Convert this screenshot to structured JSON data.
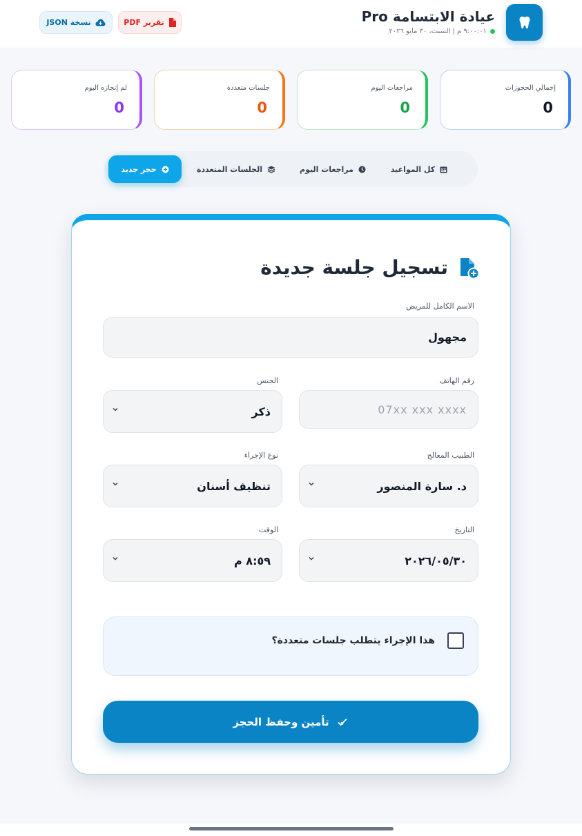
{
  "header": {
    "title": "عيادة الابتسامة Pro",
    "subtitle": "٩:٠٠:٠١ م | السبت، ٣٠ مايو ٢٠٢٦",
    "btn_pdf": "تقرير PDF",
    "btn_json": "نسخة JSON"
  },
  "stats": [
    {
      "label": "إجمالي الحجوزات",
      "value": "0"
    },
    {
      "label": "مراجعات اليوم",
      "value": "0"
    },
    {
      "label": "جلسات متعددة",
      "value": "0"
    },
    {
      "label": "لم إنجازه اليوم",
      "value": "0"
    }
  ],
  "tabs": {
    "all": "كل المواعيد",
    "today": "مراجعات اليوم",
    "multi": "الجلسات المتعددة",
    "new": "حجز جديد"
  },
  "form": {
    "title": "تسجيل جلسة جديدة",
    "name_label": "الاسم الكامل للمريض",
    "name_value": "مجهول",
    "phone_label": "رقم الهاتف",
    "phone_placeholder": "07xx  xxx  xxxx",
    "gender_label": "الجنس",
    "gender_value": "ذكر",
    "doctor_label": "الطبيب المعالج",
    "doctor_value": "د. سارة المنصور",
    "procedure_label": "نوع الإجراء",
    "procedure_value": "تنظيف أسنان",
    "date_label": "التاريخ",
    "date_value": "٢٠٢٦/٠٥/٣٠",
    "time_label": "الوقت",
    "time_value": "٨:٥٩ م",
    "multi_label": "هذا الإجراء يتطلب جلسات متعددة؟",
    "submit": "تأمين وحفظ الحجز"
  },
  "colors": {
    "primary": "#0b84c6",
    "accent": "#0ea5e9",
    "blue": "#3b82f6",
    "green": "#22c55e",
    "orange": "#f97316",
    "purple": "#a855f7"
  }
}
